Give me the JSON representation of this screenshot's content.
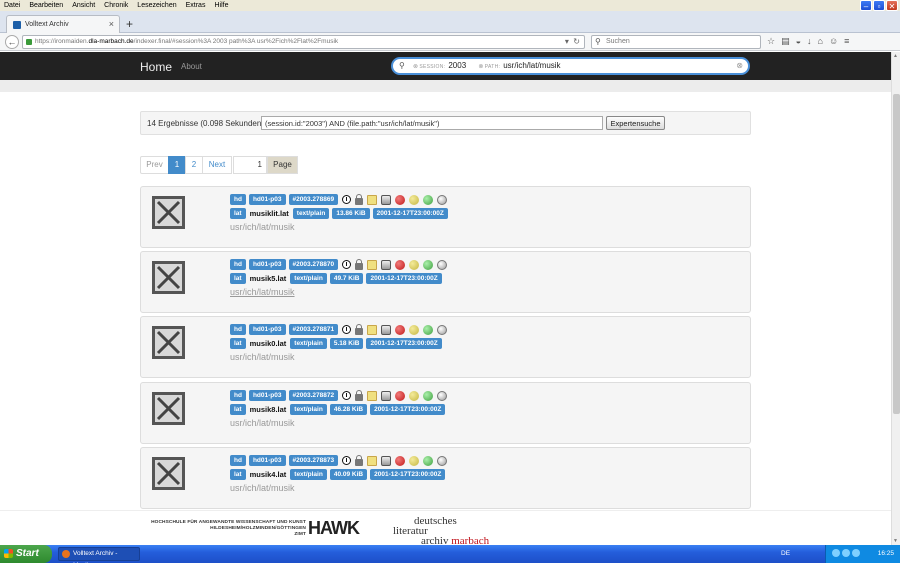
{
  "menubar": {
    "items": [
      "Datei",
      "Bearbeiten",
      "Ansicht",
      "Chronik",
      "Lesezeichen",
      "Extras",
      "Hilfe"
    ]
  },
  "browser": {
    "tab_title": "Volltext Archiv",
    "url_prefix": "https://ironmaiden.",
    "url_host": "dla-marbach.de",
    "url_rest": "/indexer.final/#session%3A 2003 path%3A usr%2Fich%2Flat%2Fmusik",
    "search_placeholder": "Suchen"
  },
  "app": {
    "brand": "Home",
    "about": "About",
    "query": {
      "tags": [
        {
          "label": "SESSION:",
          "value": "2003"
        },
        {
          "label": "PATH:",
          "value": "usr/ich/lat/musik"
        }
      ]
    }
  },
  "results": {
    "summary": "14 Ergebnisse (0.098 Sekunden)",
    "expert_query": "(session.id:\"2003\") AND (file.path:\"usr/ich/lat/musik\")",
    "expert_button": "Expertensuche"
  },
  "pager": {
    "prev": "Prev",
    "pages": [
      "1",
      "2"
    ],
    "next": "Next",
    "page_input": "1",
    "page_button": "Page"
  },
  "items": [
    {
      "type": "hd",
      "device": "hd01-p03",
      "id": "#2003.278869",
      "lang": "lat",
      "file": "musiklit.lat",
      "mime": "text/plain",
      "size": "13.86 KiB",
      "date": "2001-12-17T23:00:00Z",
      "path": "usr/ich/lat/musik"
    },
    {
      "type": "hd",
      "device": "hd01-p03",
      "id": "#2003.278870",
      "lang": "lat",
      "file": "musik5.lat",
      "mime": "text/plain",
      "size": "49.7 KiB",
      "date": "2001-12-17T23:00:00Z",
      "path": "usr/ich/lat/musik"
    },
    {
      "type": "hd",
      "device": "hd01-p03",
      "id": "#2003.278871",
      "lang": "lat",
      "file": "musik0.lat",
      "mime": "text/plain",
      "size": "5.18 KiB",
      "date": "2001-12-17T23:00:00Z",
      "path": "usr/ich/lat/musik"
    },
    {
      "type": "hd",
      "device": "hd01-p03",
      "id": "#2003.278872",
      "lang": "lat",
      "file": "musik8.lat",
      "mime": "text/plain",
      "size": "46.28 KiB",
      "date": "2001-12-17T23:00:00Z",
      "path": "usr/ich/lat/musik"
    },
    {
      "type": "hd",
      "device": "hd01-p03",
      "id": "#2003.278873",
      "lang": "lat",
      "file": "musik4.lat",
      "mime": "text/plain",
      "size": "40.09 KiB",
      "date": "2001-12-17T23:00:00Z",
      "path": "usr/ich/lat/musik"
    }
  ],
  "footer": {
    "hawk_lines": [
      "HOCHSCHULE FÜR ANGEWANDTE WISSENSCHAFT UND KUNST",
      "HILDESHEIM/HOLZMINDEN/GÖTTINGEN",
      "ZIMT"
    ],
    "hawk_logo": "HAWK",
    "dla_lines": [
      "deutsches",
      "literatur",
      "archiv"
    ],
    "dla_red": "marbach"
  },
  "taskbar": {
    "start": "Start",
    "task": "Volltext Archiv - Mozil...",
    "lang": "DE",
    "clock": "16:25"
  }
}
